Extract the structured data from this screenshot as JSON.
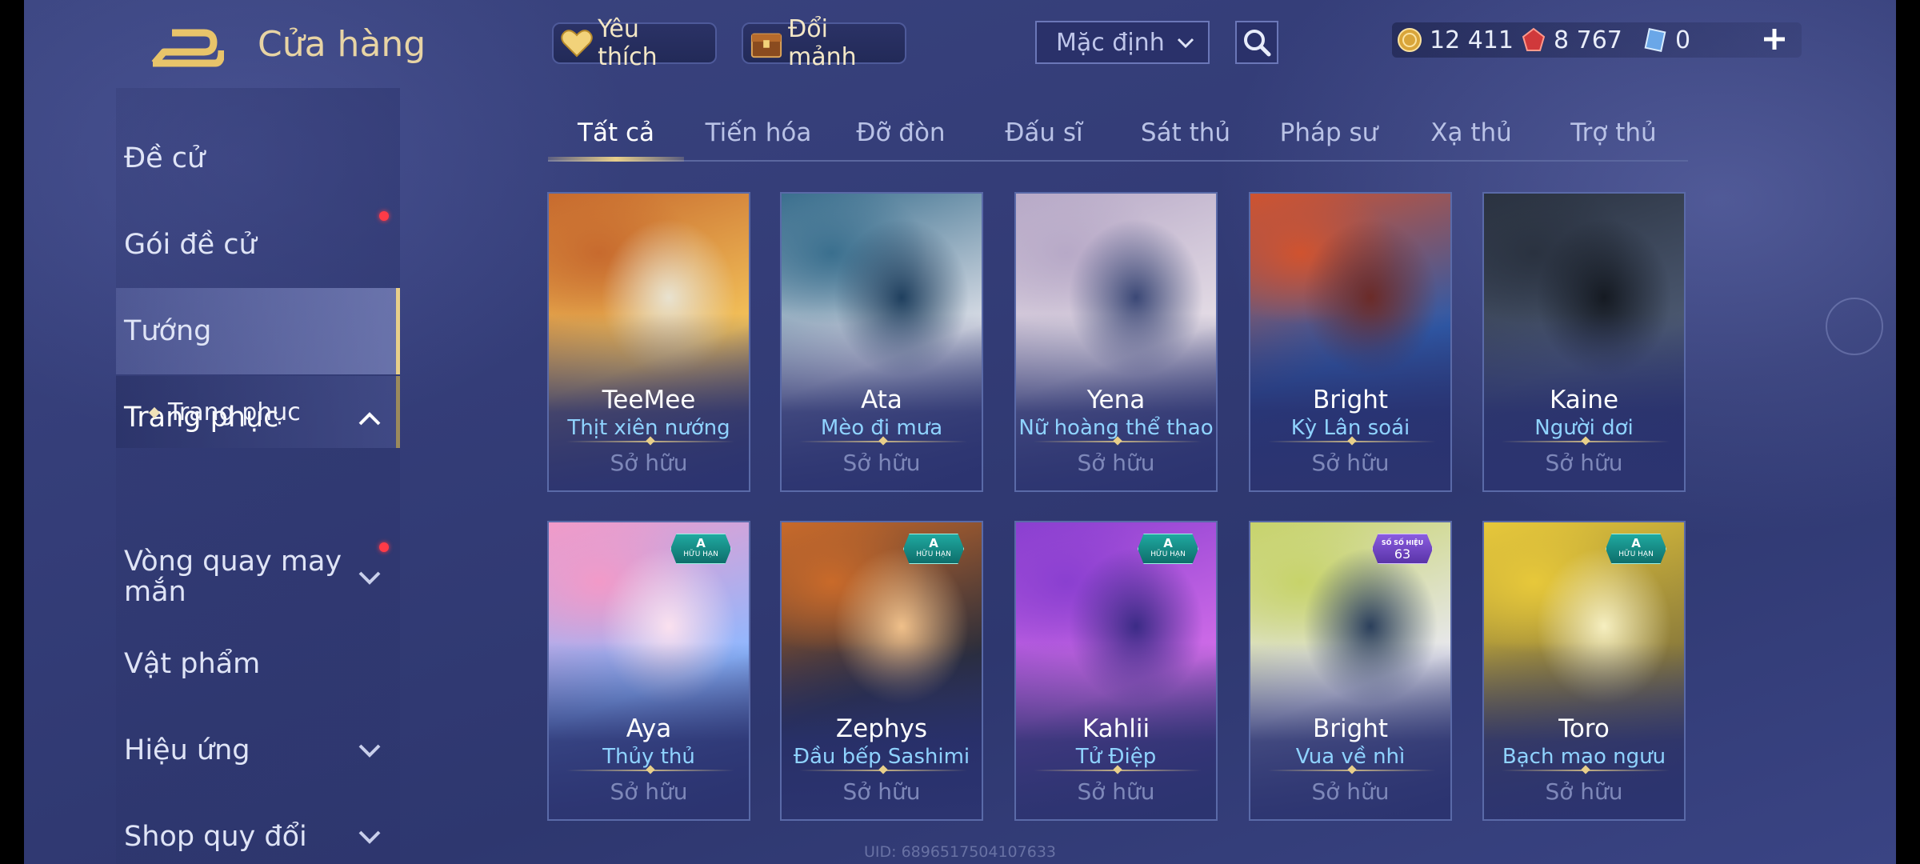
{
  "header": {
    "title": "Cửa hàng",
    "favorites_label": "Yêu thích",
    "shards_label": "Đổi mảnh",
    "sort_value": "Mặc định"
  },
  "currencies": {
    "gold": "12 411",
    "ruby": "8 767",
    "gem": "0"
  },
  "sidebar": {
    "items": [
      {
        "label": "Đề cử"
      },
      {
        "label": "Gói đề cử"
      },
      {
        "label": "Tướng"
      },
      {
        "label": "Trang phục"
      },
      {
        "label": "Vòng quay may mắn"
      },
      {
        "label": "Vật phẩm"
      },
      {
        "label": "Hiệu ứng"
      },
      {
        "label": "Shop quy đổi"
      }
    ],
    "sub_item": "Trang phục"
  },
  "tabs": [
    {
      "label": "Tất cả",
      "active": true
    },
    {
      "label": "Tiến hóa"
    },
    {
      "label": "Đỡ đòn"
    },
    {
      "label": "Đấu sĩ"
    },
    {
      "label": "Sát thủ"
    },
    {
      "label": "Pháp sư"
    },
    {
      "label": "Xạ thủ"
    },
    {
      "label": "Trợ thủ"
    }
  ],
  "cards": [
    {
      "hero": "TeeMee",
      "skin": "Thịt xiên nướng",
      "status": "Sở hữu",
      "palette": [
        "#c76a2e",
        "#f3c25a",
        "#e8e2d0"
      ]
    },
    {
      "hero": "Ata",
      "skin": "Mèo đi mưa",
      "status": "Sở hữu",
      "palette": [
        "#3a6f8e",
        "#d9dde6",
        "#1f3f5e"
      ]
    },
    {
      "hero": "Yena",
      "skin": "Nữ hoàng thể thao",
      "status": "Sở hữu",
      "palette": [
        "#b7a9c7",
        "#e5dde6",
        "#3b4876"
      ]
    },
    {
      "hero": "Bright",
      "skin": "Kỳ Lân soái",
      "status": "Sở hữu",
      "palette": [
        "#d0532f",
        "#2f5aa8",
        "#6b2b28"
      ]
    },
    {
      "hero": "Kaine",
      "skin": "Người dơi",
      "status": "Sở hữu",
      "palette": [
        "#2a3240",
        "#4b5870",
        "#151a22"
      ]
    },
    {
      "hero": "Aya",
      "skin": "Thủy thủ",
      "status": "Sở hữu",
      "palette": [
        "#f29ac8",
        "#8fb8ff",
        "#fbe1ef"
      ],
      "badge_top": "A",
      "badge_bottom": "HỮU HẠN"
    },
    {
      "hero": "Zephys",
      "skin": "Đầu bếp Sashimi",
      "status": "Sở hữu",
      "palette": [
        "#c96a2a",
        "#2a2d3b",
        "#f0c08a"
      ],
      "badge_top": "A",
      "badge_bottom": "HỮU HẠN"
    },
    {
      "hero": "Kahlii",
      "skin": "Tử Điệp",
      "status": "Sở hữu",
      "palette": [
        "#8a3fd0",
        "#d06ce8",
        "#3b2b86"
      ],
      "badge_top": "A",
      "badge_bottom": "HỮU HẠN"
    },
    {
      "hero": "Bright",
      "skin": "Vua về nhì",
      "status": "Sở hữu",
      "palette": [
        "#c7d36a",
        "#e8e8ef",
        "#2b3f5b"
      ],
      "badge_top": "SỐ SỐ HIỆU",
      "badge_bottom": "63"
    },
    {
      "hero": "Toro",
      "skin": "Bạch mao ngưu",
      "status": "Sở hữu",
      "palette": [
        "#e7c83a",
        "#8a7a3b",
        "#f6efc0"
      ],
      "badge_top": "A",
      "badge_bottom": "HỮU HẠN"
    }
  ],
  "footer": {
    "uid": "UID: 6896517504107633"
  }
}
